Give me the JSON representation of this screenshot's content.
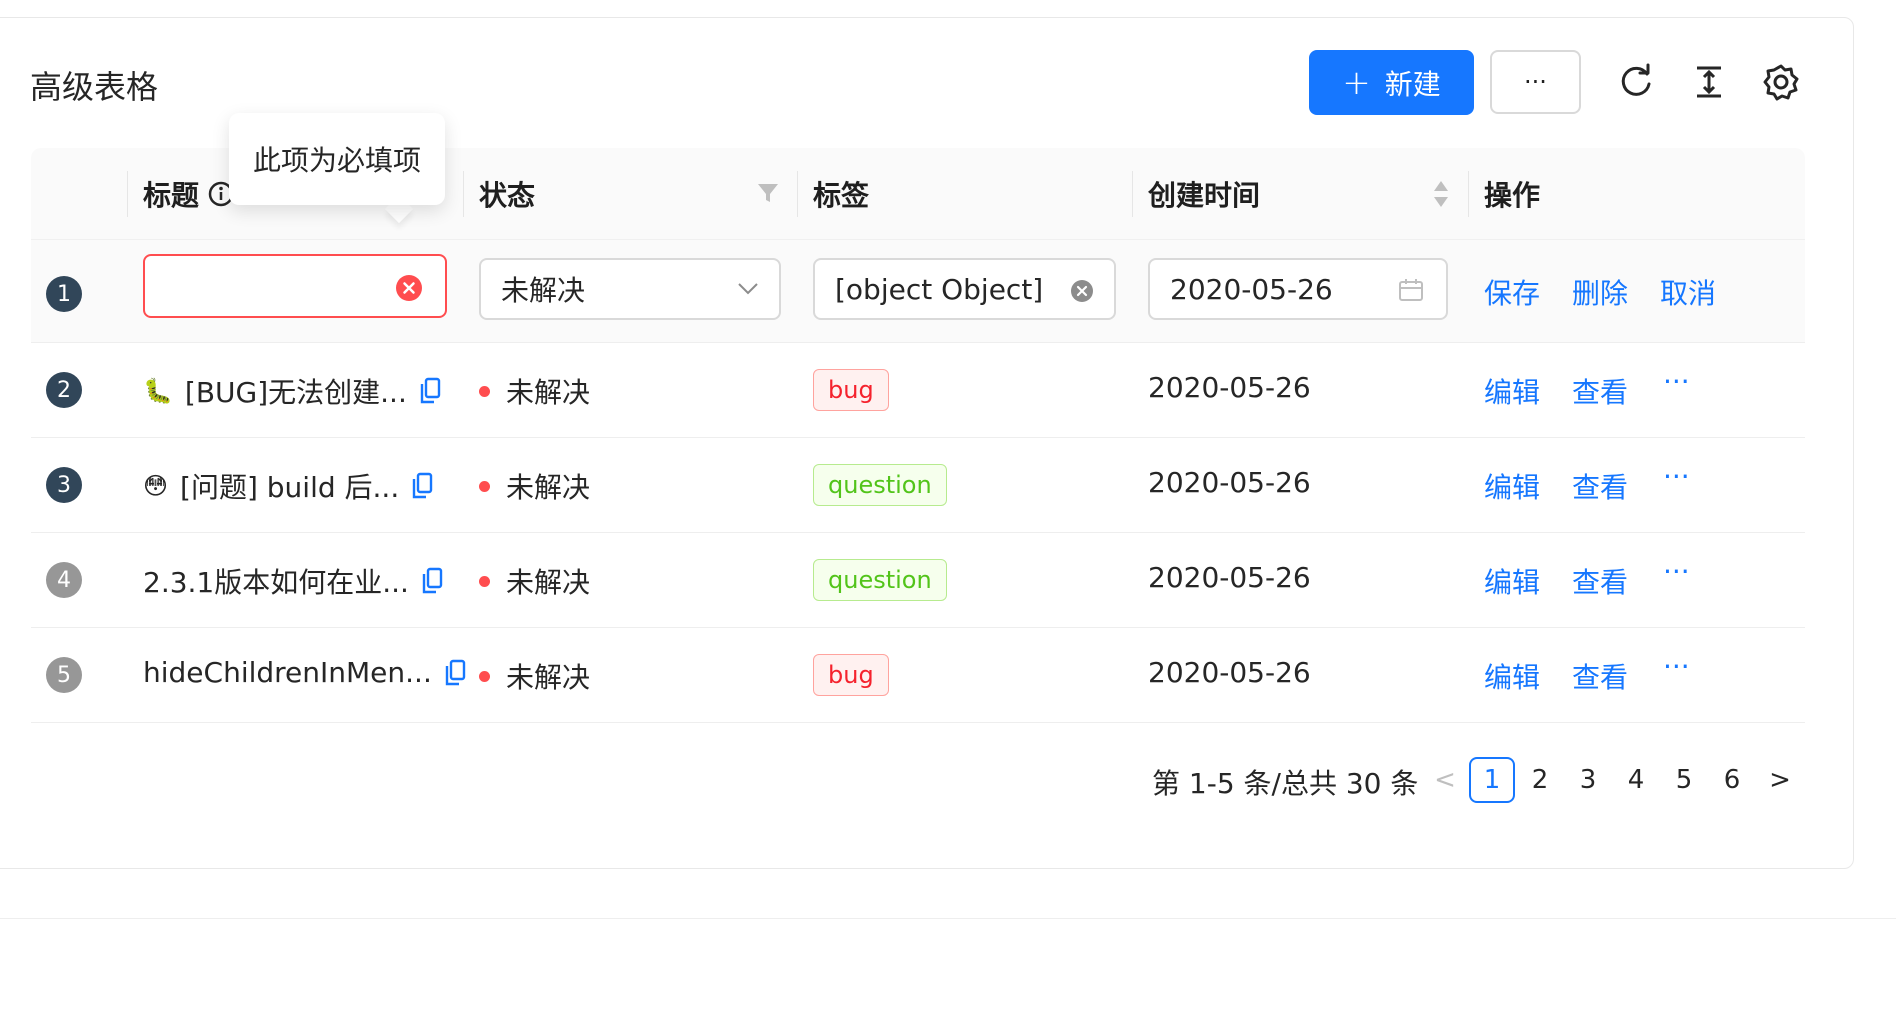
{
  "header": {
    "title": "高级表格",
    "new_label": "新建",
    "new_icon": "plus-icon",
    "more_label": "···"
  },
  "toolbar_icons": [
    "reload-icon",
    "density-icon",
    "settings-icon"
  ],
  "columns": {
    "title": "标题",
    "status": "状态",
    "tags": "标签",
    "created": "创建时间",
    "actions": "操作"
  },
  "tooltip": "此项为必填项",
  "edit_row": {
    "index": "1",
    "title_value": "",
    "status_value": "未解决",
    "tag_value": "[object Object]",
    "date_value": "2020-05-26",
    "actions": {
      "save": "保存",
      "delete": "删除",
      "cancel": "取消"
    }
  },
  "rows": [
    {
      "index": "2",
      "emoji": "🐛",
      "title": "[BUG]无法创建...",
      "status": "未解决",
      "tag": "bug",
      "tag_color": "red",
      "date": "2020-05-26"
    },
    {
      "index": "3",
      "emoji": "😳",
      "title": "[问题] build 后...",
      "status": "未解决",
      "tag": "question",
      "tag_color": "green",
      "date": "2020-05-26"
    },
    {
      "index": "4",
      "emoji": "",
      "title": "2.3.1版本如何在业...",
      "status": "未解决",
      "tag": "question",
      "tag_color": "green",
      "date": "2020-05-26"
    },
    {
      "index": "5",
      "emoji": "",
      "title": "hideChildrenInMen...",
      "status": "未解决",
      "tag": "bug",
      "tag_color": "red",
      "date": "2020-05-26"
    }
  ],
  "row_actions": {
    "edit": "编辑",
    "view": "查看",
    "more": "···"
  },
  "pagination": {
    "total_text": "第 1-5 条/总共 30 条",
    "pages": [
      "1",
      "2",
      "3",
      "4",
      "5",
      "6"
    ],
    "current": "1",
    "prev": "<",
    "next": ">"
  },
  "colors": {
    "primary": "#1677ff",
    "error": "#ff4d4f",
    "bug_tag": "#f5222d",
    "question_tag": "#52c41a",
    "index_dark": "#314659",
    "index_grey": "#979797"
  }
}
